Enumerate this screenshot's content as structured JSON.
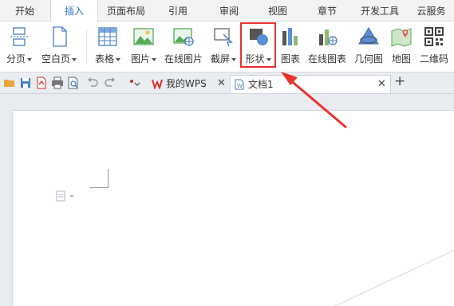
{
  "menu": {
    "tabs": [
      {
        "label": "开始"
      },
      {
        "label": "插入"
      },
      {
        "label": "页面布局"
      },
      {
        "label": "引用"
      },
      {
        "label": "审阅"
      },
      {
        "label": "视图"
      },
      {
        "label": "章节"
      },
      {
        "label": "开发工具"
      },
      {
        "label": "云服务"
      }
    ],
    "active_tab": "插入"
  },
  "ribbon": {
    "buttons": [
      {
        "label": "分页",
        "icon": "page-break-icon",
        "dropdown": true
      },
      {
        "label": "空白页",
        "icon": "blank-page-icon",
        "dropdown": true
      },
      {
        "label": "表格",
        "icon": "table-icon",
        "dropdown": true
      },
      {
        "label": "图片",
        "icon": "picture-icon",
        "dropdown": true
      },
      {
        "label": "在线图片",
        "icon": "online-picture-icon",
        "dropdown": false
      },
      {
        "label": "截屏",
        "icon": "screenshot-icon",
        "dropdown": true
      },
      {
        "label": "形状",
        "icon": "shapes-icon",
        "dropdown": true
      },
      {
        "label": "图表",
        "icon": "chart-icon",
        "dropdown": false
      },
      {
        "label": "在线图表",
        "icon": "online-chart-icon",
        "dropdown": false
      },
      {
        "label": "几何图",
        "icon": "geometry-icon",
        "dropdown": false
      },
      {
        "label": "地图",
        "icon": "map-icon",
        "dropdown": false
      },
      {
        "label": "二维码",
        "icon": "qrcode-icon",
        "dropdown": false
      }
    ],
    "highlighted": "形状"
  },
  "tabbar": {
    "tabs": [
      {
        "label": "我的WPS",
        "icon": "wps-logo-icon"
      },
      {
        "label": "文档1",
        "icon": "document-icon"
      }
    ],
    "new_tab_label": "+"
  },
  "colors": {
    "accent": "#2f74c9",
    "highlight": "#e8322e",
    "wps_red": "#d9302b"
  }
}
